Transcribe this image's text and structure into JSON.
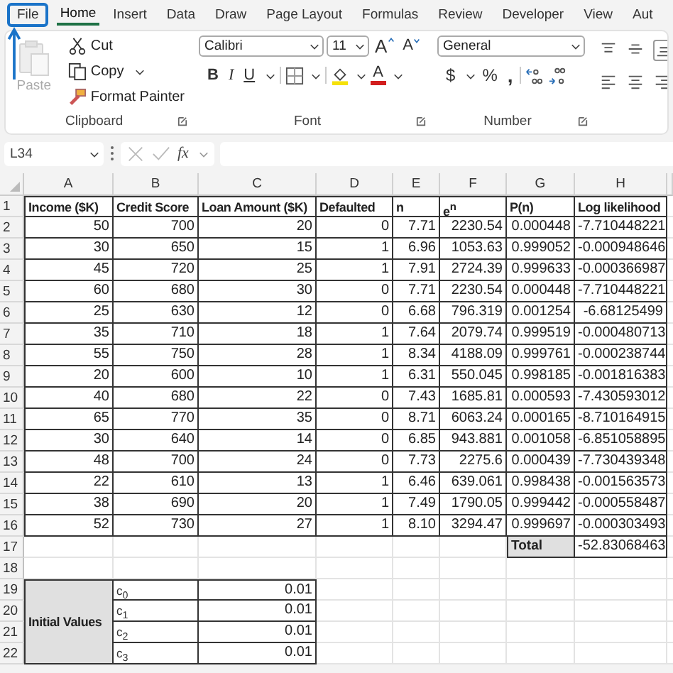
{
  "ribbon_tabs": [
    {
      "label": "File",
      "selected": false,
      "highlighted": true
    },
    {
      "label": "Home",
      "selected": true,
      "highlighted": false
    },
    {
      "label": "Insert",
      "selected": false,
      "highlighted": false
    },
    {
      "label": "Data",
      "selected": false,
      "highlighted": false
    },
    {
      "label": "Draw",
      "selected": false,
      "highlighted": false
    },
    {
      "label": "Page Layout",
      "selected": false,
      "highlighted": false
    },
    {
      "label": "Formulas",
      "selected": false,
      "highlighted": false
    },
    {
      "label": "Review",
      "selected": false,
      "highlighted": false
    },
    {
      "label": "Developer",
      "selected": false,
      "highlighted": false
    },
    {
      "label": "View",
      "selected": false,
      "highlighted": false
    },
    {
      "label": "Aut",
      "selected": false,
      "highlighted": false
    }
  ],
  "clipboard": {
    "paste": {
      "label": "Paste",
      "disabled": true
    },
    "items": [
      {
        "kind": "cut",
        "label": "Cut"
      },
      {
        "kind": "copy",
        "label": "Copy"
      },
      {
        "kind": "painter",
        "label": "Format Painter"
      }
    ],
    "group_label": "Clipboard"
  },
  "font": {
    "name": "Calibri",
    "size": "11",
    "grow": "A",
    "shrink": "A",
    "bold": "B",
    "italic": "I",
    "underline": "U",
    "font_color": "A",
    "group_label": "Font"
  },
  "number": {
    "format": "General",
    "currency": "$",
    "percent": "%",
    "comma": ",",
    "group_label": "Number"
  },
  "formula_bar": {
    "name_box": "L34",
    "fx": "fx"
  },
  "columns": [
    "A",
    "B",
    "C",
    "D",
    "E",
    "F",
    "G",
    "H"
  ],
  "rows": [
    {
      "number": "1",
      "kind": "header",
      "cells": [
        "Income ($K)",
        "Credit Score",
        "Loan Amount ($K)",
        "Defaulted",
        "n",
        "e$^{n}$",
        "P(n)",
        "Log likelihood"
      ]
    },
    {
      "number": "2",
      "kind": "data",
      "cells": [
        "50",
        "700",
        "20",
        "0",
        "7.71",
        "2230.54",
        "0.000448",
        "-7.710448221"
      ]
    },
    {
      "number": "3",
      "kind": "data",
      "cells": [
        "30",
        "650",
        "15",
        "1",
        "6.96",
        "1053.63",
        "0.999052",
        "-0.000948646"
      ]
    },
    {
      "number": "4",
      "kind": "data",
      "cells": [
        "45",
        "720",
        "25",
        "1",
        "7.91",
        "2724.39",
        "0.999633",
        "-0.000366987"
      ]
    },
    {
      "number": "5",
      "kind": "data",
      "cells": [
        "60",
        "680",
        "30",
        "0",
        "7.71",
        "2230.54",
        "0.000448",
        "-7.710448221"
      ]
    },
    {
      "number": "6",
      "kind": "data",
      "cells": [
        "25",
        "630",
        "12",
        "0",
        "6.68",
        "796.319",
        "0.001254",
        "-6.68125499"
      ]
    },
    {
      "number": "7",
      "kind": "data",
      "cells": [
        "35",
        "710",
        "18",
        "1",
        "7.64",
        "2079.74",
        "0.999519",
        "-0.000480713"
      ]
    },
    {
      "number": "8",
      "kind": "data",
      "cells": [
        "55",
        "750",
        "28",
        "1",
        "8.34",
        "4188.09",
        "0.999761",
        "-0.000238744"
      ]
    },
    {
      "number": "9",
      "kind": "data",
      "cells": [
        "20",
        "600",
        "10",
        "1",
        "6.31",
        "550.045",
        "0.998185",
        "-0.001816383"
      ]
    },
    {
      "number": "10",
      "kind": "data",
      "cells": [
        "40",
        "680",
        "22",
        "0",
        "7.43",
        "1685.81",
        "0.000593",
        "-7.430593012"
      ]
    },
    {
      "number": "11",
      "kind": "data",
      "cells": [
        "65",
        "770",
        "35",
        "0",
        "8.71",
        "6063.24",
        "0.000165",
        "-8.710164915"
      ]
    },
    {
      "number": "12",
      "kind": "data",
      "cells": [
        "30",
        "640",
        "14",
        "0",
        "6.85",
        "943.881",
        "0.001058",
        "-6.851058895"
      ]
    },
    {
      "number": "13",
      "kind": "data",
      "cells": [
        "48",
        "700",
        "24",
        "0",
        "7.73",
        "2275.6",
        "0.000439",
        "-7.730439348"
      ]
    },
    {
      "number": "14",
      "kind": "data",
      "cells": [
        "22",
        "610",
        "13",
        "1",
        "6.46",
        "639.061",
        "0.998438",
        "-0.001563573"
      ]
    },
    {
      "number": "15",
      "kind": "data",
      "cells": [
        "38",
        "690",
        "20",
        "1",
        "7.49",
        "1790.05",
        "0.999442",
        "-0.000558487"
      ]
    },
    {
      "number": "16",
      "kind": "data",
      "cells": [
        "52",
        "730",
        "27",
        "1",
        "8.10",
        "3294.47",
        "0.999697",
        "-0.000303493"
      ]
    },
    {
      "number": "17",
      "kind": "total",
      "cells": [
        null,
        null,
        null,
        null,
        null,
        null,
        "Total",
        "-52.83068463"
      ]
    },
    {
      "number": "18"
    },
    {
      "number": "19"
    },
    {
      "number": "20"
    },
    {
      "number": "21"
    },
    {
      "number": "22"
    }
  ],
  "initial_values": {
    "label": "Initial Values",
    "params": [
      {
        "name": "c$_{0}$",
        "value": "0.01"
      },
      {
        "name": "c$_{1}$",
        "value": "0.01"
      },
      {
        "name": "c$_{2}$",
        "value": "0.01"
      },
      {
        "name": "c$_{3}$",
        "value": "0.01"
      }
    ]
  }
}
